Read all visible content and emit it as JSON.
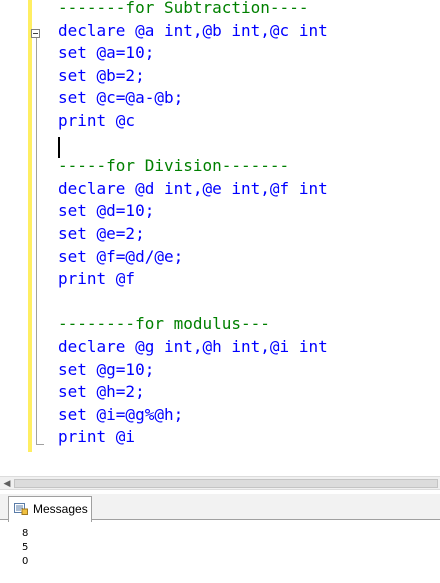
{
  "editor": {
    "lines": [
      {
        "text": "-------for Subtraction----",
        "kind": "comment"
      },
      {
        "text": "declare @a int,@b int,@c int",
        "kind": "code"
      },
      {
        "text": "set @a=10;",
        "kind": "code"
      },
      {
        "text": "set @b=2;",
        "kind": "code"
      },
      {
        "text": "set @c=@a-@b;",
        "kind": "code"
      },
      {
        "text": "print @c",
        "kind": "code"
      },
      {
        "text": "",
        "kind": "code"
      },
      {
        "text": "-----for Division-------",
        "kind": "comment"
      },
      {
        "text": "declare @d int,@e int,@f int",
        "kind": "code"
      },
      {
        "text": "set @d=10;",
        "kind": "code"
      },
      {
        "text": "set @e=2;",
        "kind": "code"
      },
      {
        "text": "set @f=@d/@e;",
        "kind": "code"
      },
      {
        "text": "print @f",
        "kind": "code"
      },
      {
        "text": "",
        "kind": "code"
      },
      {
        "text": "--------for modulus---",
        "kind": "comment"
      },
      {
        "text": "declare @g int,@h int,@i int",
        "kind": "code"
      },
      {
        "text": "set @g=10;",
        "kind": "code"
      },
      {
        "text": "set @h=2;",
        "kind": "code"
      },
      {
        "text": "set @i=@g%@h;",
        "kind": "code"
      },
      {
        "text": "print @i",
        "kind": "code"
      }
    ]
  },
  "results": {
    "tab_label": "Messages",
    "messages": [
      "8",
      "5",
      "0"
    ]
  },
  "icons": {
    "fold": "collapse-minus-icon",
    "scroll_left": "scroll-left-arrow-icon",
    "messages_tab": "messages-icon"
  },
  "colors": {
    "keyword": "#0000ff",
    "comment": "#008000",
    "changed_margin": "#ffee62"
  }
}
